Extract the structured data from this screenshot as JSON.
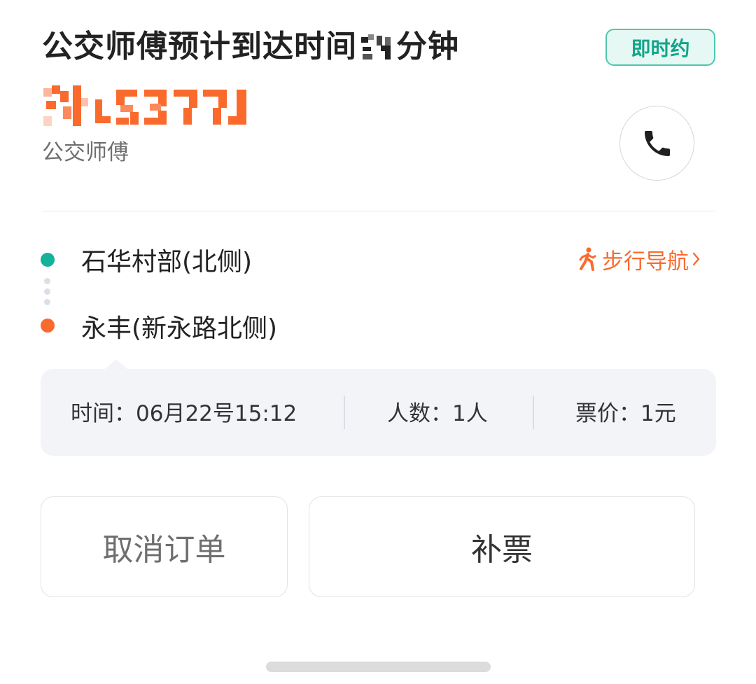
{
  "header": {
    "title_prefix": "公交师傅预计到达时间",
    "title_suffix": "分钟",
    "tag": "即时约"
  },
  "driver": {
    "role": "公交师傅",
    "call_icon": "phone-icon"
  },
  "route": {
    "start": "石华村部(北侧)",
    "end": "永丰(新永路北侧)",
    "walk_nav_label": "步行导航",
    "walk_icon": "walking-person-icon",
    "chevron_icon": "chevron-right-icon"
  },
  "info": {
    "time": "时间：06月22号15:12",
    "people": "人数：1人",
    "price": "票价：1元"
  },
  "actions": {
    "cancel": "取消订单",
    "supplement": "补票"
  },
  "colors": {
    "accent_green": "#13b29b",
    "accent_orange": "#fa6a2d",
    "tag_bg": "#e6f8f3",
    "card_bg": "#f2f4f8"
  }
}
